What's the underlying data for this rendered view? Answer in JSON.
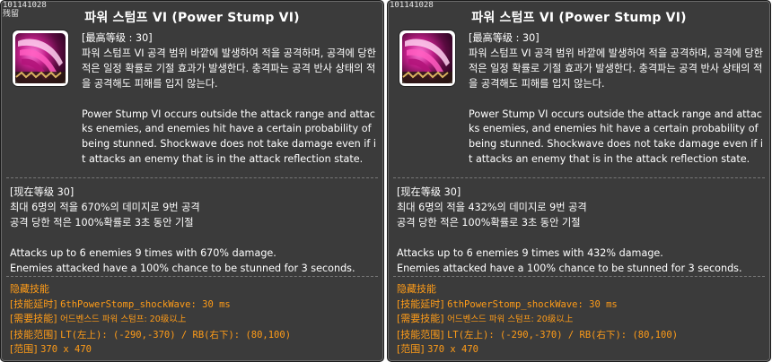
{
  "tooltips": [
    {
      "skill_id": "101141028",
      "tag": "残留",
      "title": "파워 스텀프 VI (Power Stump VI)",
      "max_level": "[最高等级 : 30]",
      "desc_kr": "파워 스텀프 VI 공격 범위 바깥에 발생하여 적을 공격하며, 공격에 당한 적은 일정 확률로 기절 효과가 발생한다. 충격파는 공격 반사 상태의 적을 공격해도 피해를 입지 않는다.",
      "desc_en": "Power Stump VI occurs outside the attack range and attacks enemies, and enemies hit have a certain probability of being stunned. Shockwave does not take damage even if it attacks an enemy that is in the attack reflection state.",
      "cur_level": "[现在等级 30]",
      "cur_kr_1": "최대 6명의 적을 670%의 데미지로 9번 공격",
      "cur_kr_2": "공격 당한 적은 100%확률로 3초 동안 기절",
      "cur_en_1": "Attacks up to 6 enemies 9 times with 670% damage.",
      "cur_en_2": "Enemies attacked have a 100% chance to be stunned for 3 seconds.",
      "hidden_header": "隐藏技能",
      "delay_label": "[技能延时]",
      "delay_value": "6thPowerStomp_shockWave: 30 ms",
      "req_label": "[需要技能]",
      "req_value": "어드벤스드 파워 스텀프: 20级以上",
      "range_label": "[技能范围]",
      "range_value": "LT(左上): (-290,-370) / RB(右下): (80,100)",
      "area_label": "[范围]",
      "area_value": "370 x 470"
    },
    {
      "skill_id": "101141028",
      "tag": "",
      "title": "파워 스텀프 VI (Power Stump VI)",
      "max_level": "[最高等级 : 30]",
      "desc_kr": "파워 스텀프 VI 공격 범위 바깥에 발생하여 적을 공격하며, 공격에 당한 적은 일정 확률로 기절 효과가 발생한다. 충격파는 공격 반사 상태의 적을 공격해도 피해를 입지 않는다.",
      "desc_en": "Power Stump VI occurs outside the attack range and attacks enemies, and enemies hit have a certain probability of being stunned. Shockwave does not take damage even if it attacks an enemy that is in the attack reflection state.",
      "cur_level": "[现在等级 30]",
      "cur_kr_1": "최대 6명의 적을 432%의 데미지로 9번 공격",
      "cur_kr_2": "공격 당한 적은 100%확률로 3초 동안 기절",
      "cur_en_1": "Attacks up to 6 enemies 9 times with 432% damage.",
      "cur_en_2": "Enemies attacked have a 100% chance to be stunned for 3 seconds.",
      "hidden_header": "隐藏技能",
      "delay_label": "[技能延时]",
      "delay_value": "6thPowerStomp_shockWave: 30 ms",
      "req_label": "[需要技能]",
      "req_value": "어드벤스드 파워 스텀프: 20级以上",
      "range_label": "[技能范围]",
      "range_value": "LT(左上): (-290,-370) / RB(右下): (80,100)",
      "area_label": "[范围]",
      "area_value": "370 x 470"
    }
  ],
  "icon_name": "power-stump-skill-icon",
  "colors": {
    "panel_bg": "#3b3b3b",
    "text": "#ffffff",
    "hidden_text": "#ff9c18"
  }
}
